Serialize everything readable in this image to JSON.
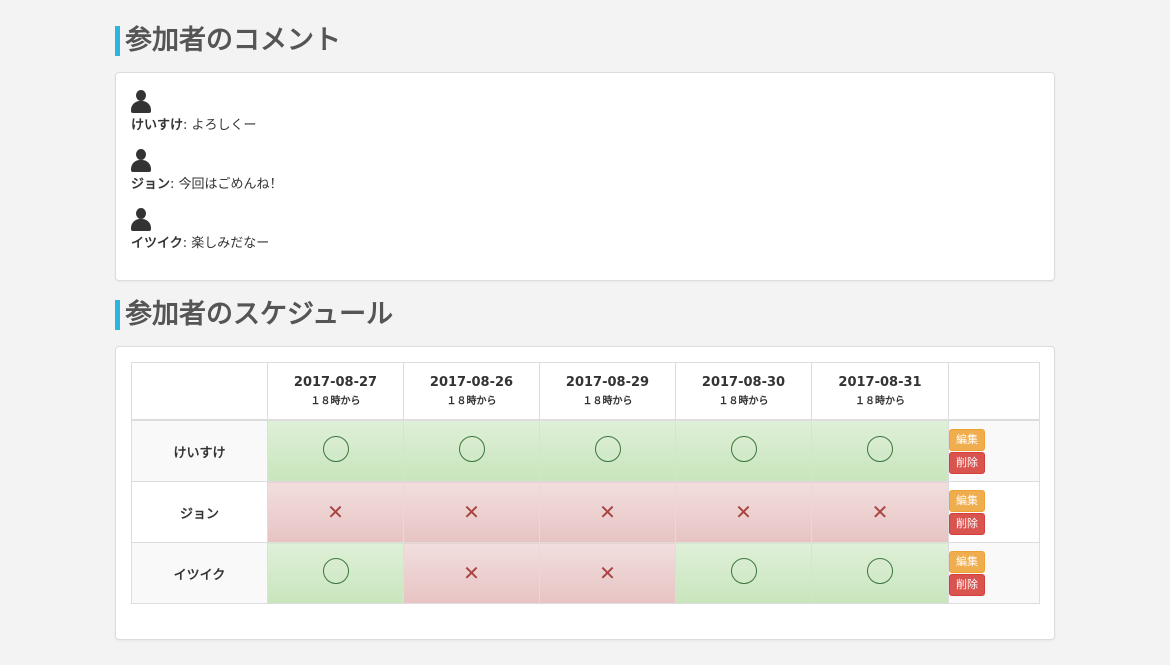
{
  "comments_section": {
    "title": "参加者のコメント",
    "items": [
      {
        "name": "けいすけ",
        "separator": ": ",
        "text": "よろしくー"
      },
      {
        "name": "ジョン",
        "separator": ": ",
        "text": "今回はごめんね！"
      },
      {
        "name": "イツイク",
        "separator": ": ",
        "text": "楽しみだなー"
      }
    ]
  },
  "schedule_section": {
    "title": "参加者のスケジュール",
    "dates": [
      {
        "date": "2017-08-27",
        "time": "１８時から"
      },
      {
        "date": "2017-08-26",
        "time": "１８時から"
      },
      {
        "date": "2017-08-29",
        "time": "１８時から"
      },
      {
        "date": "2017-08-30",
        "time": "１８時から"
      },
      {
        "date": "2017-08-31",
        "time": "１８時から"
      }
    ],
    "rows": [
      {
        "name": "けいすけ",
        "availability": [
          "ok",
          "ok",
          "ok",
          "ok",
          "ok"
        ]
      },
      {
        "name": "ジョン",
        "availability": [
          "ng",
          "ng",
          "ng",
          "ng",
          "ng"
        ]
      },
      {
        "name": "イツイク",
        "availability": [
          "ok",
          "ng",
          "ng",
          "ok",
          "ok"
        ]
      }
    ],
    "ng_mark": "✕",
    "edit_label": "編集",
    "delete_label": "削除"
  },
  "colors": {
    "heading_accent": "#2bb6e0",
    "ok_cell": "#dff0d8",
    "ng_cell": "#f2dede",
    "edit_button": "#f0ad4e",
    "delete_button": "#d9534f"
  }
}
